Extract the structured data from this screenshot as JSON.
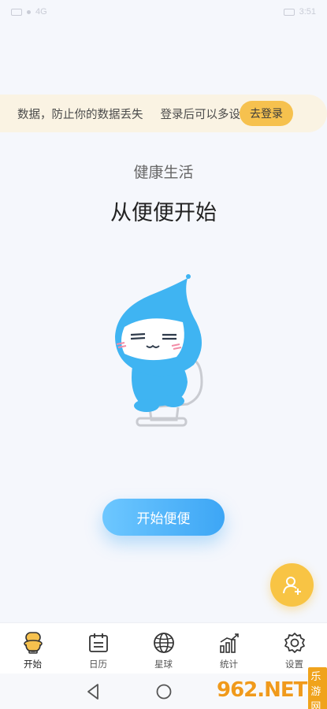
{
  "status": {
    "left_text": "4G",
    "right_text": "3:51"
  },
  "banner": {
    "text_part1": "数据，防止你的数据丢失",
    "text_part2": "登录后可以多设",
    "login_label": "去登录"
  },
  "hero": {
    "subtitle": "健康生活",
    "title": "从便便开始"
  },
  "main": {
    "start_label": "开始便便"
  },
  "tabs": [
    {
      "label": "开始",
      "icon": "toilet-icon",
      "active": true
    },
    {
      "label": "日历",
      "icon": "calendar-icon",
      "active": false
    },
    {
      "label": "星球",
      "icon": "globe-icon",
      "active": false
    },
    {
      "label": "统计",
      "icon": "chart-icon",
      "active": false
    },
    {
      "label": "设置",
      "icon": "gear-icon",
      "active": false
    }
  ],
  "watermark": {
    "logo": "962.NET",
    "sub": "乐游网"
  },
  "colors": {
    "accent_blue": "#3da6f5",
    "accent_yellow": "#f6c14e",
    "banner_bg": "#faf3e3",
    "page_bg": "#f5f7fc"
  }
}
